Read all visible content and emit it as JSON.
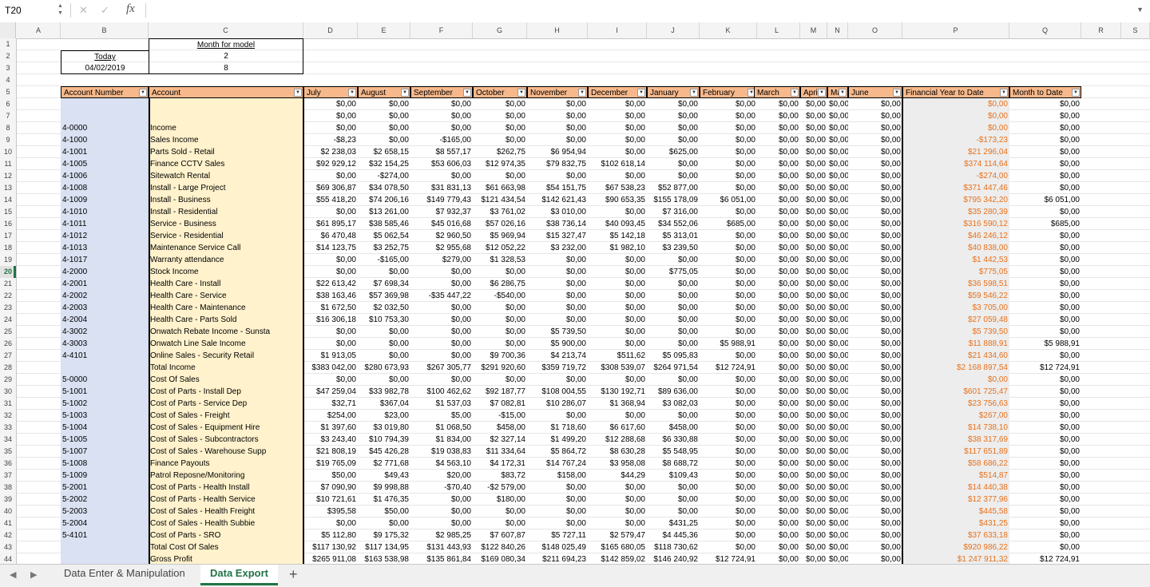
{
  "formula_bar": {
    "name_box": "T20",
    "fx_label": "fx",
    "formula": "",
    "cancel_icon": "close-icon",
    "confirm_icon": "check-icon"
  },
  "columns": [
    "A",
    "B",
    "C",
    "D",
    "E",
    "F",
    "G",
    "H",
    "I",
    "J",
    "K",
    "L",
    "M",
    "N",
    "O",
    "P",
    "Q",
    "R",
    "S"
  ],
  "selected_row": 20,
  "info": {
    "today_label": "Today",
    "today_value": "04/02/2019",
    "month_label": "Month for model",
    "month_value1": "2",
    "month_value2": "8"
  },
  "headers": [
    "Account Number",
    "Account",
    "July",
    "August",
    "September",
    "October",
    "November",
    "December",
    "January",
    "February",
    "March",
    "April",
    "May",
    "June",
    "Financial Year to Date",
    "Month to Date"
  ],
  "rows": [
    {
      "n": 6,
      "acct": "",
      "name": "",
      "v": [
        "$0,00",
        "$0,00",
        "$0,00",
        "$0,00",
        "$0,00",
        "$0,00",
        "$0,00",
        "$0,00",
        "$0,00",
        "$0,00",
        "$0,00",
        "$0,00"
      ],
      "fytd": "$0,00",
      "mtd": "$0,00"
    },
    {
      "n": 7,
      "acct": "",
      "name": "",
      "v": [
        "$0,00",
        "$0,00",
        "$0,00",
        "$0,00",
        "$0,00",
        "$0,00",
        "$0,00",
        "$0,00",
        "$0,00",
        "$0,00",
        "$0,00",
        "$0,00"
      ],
      "fytd": "$0,00",
      "mtd": "$0,00"
    },
    {
      "n": 8,
      "acct": "4-0000",
      "name": "Income",
      "v": [
        "$0,00",
        "$0,00",
        "$0,00",
        "$0,00",
        "$0,00",
        "$0,00",
        "$0,00",
        "$0,00",
        "$0,00",
        "$0,00",
        "$0,00",
        "$0,00"
      ],
      "fytd": "$0,00",
      "mtd": "$0,00"
    },
    {
      "n": 9,
      "acct": "4-1000",
      "name": "Sales Income",
      "v": [
        "-$8,23",
        "$0,00",
        "-$165,00",
        "$0,00",
        "$0,00",
        "$0,00",
        "$0,00",
        "$0,00",
        "$0,00",
        "$0,00",
        "$0,00",
        "$0,00"
      ],
      "fytd": "-$173,23",
      "mtd": "$0,00"
    },
    {
      "n": 10,
      "acct": "4-1001",
      "name": "Parts Sold - Retail",
      "v": [
        "$2 238,03",
        "$2 658,15",
        "$8 557,17",
        "$262,75",
        "$6 954,94",
        "$0,00",
        "$625,00",
        "$0,00",
        "$0,00",
        "$0,00",
        "$0,00",
        "$0,00"
      ],
      "fytd": "$21 296,04",
      "mtd": "$0,00"
    },
    {
      "n": 11,
      "acct": "4-1005",
      "name": "Finance CCTV Sales",
      "v": [
        "$92 929,12",
        "$32 154,25",
        "$53 606,03",
        "$12 974,35",
        "$79 832,75",
        "$102 618,14",
        "$0,00",
        "$0,00",
        "$0,00",
        "$0,00",
        "$0,00",
        "$0,00"
      ],
      "fytd": "$374 114,64",
      "mtd": "$0,00"
    },
    {
      "n": 12,
      "acct": "4-1006",
      "name": "Sitewatch Rental",
      "v": [
        "$0,00",
        "-$274,00",
        "$0,00",
        "$0,00",
        "$0,00",
        "$0,00",
        "$0,00",
        "$0,00",
        "$0,00",
        "$0,00",
        "$0,00",
        "$0,00"
      ],
      "fytd": "-$274,00",
      "mtd": "$0,00"
    },
    {
      "n": 13,
      "acct": "4-1008",
      "name": "Install - Large Project",
      "v": [
        "$69 306,87",
        "$34 078,50",
        "$31 831,13",
        "$61 663,98",
        "$54 151,75",
        "$67 538,23",
        "$52 877,00",
        "$0,00",
        "$0,00",
        "$0,00",
        "$0,00",
        "$0,00"
      ],
      "fytd": "$371 447,46",
      "mtd": "$0,00"
    },
    {
      "n": 14,
      "acct": "4-1009",
      "name": "Install - Business",
      "v": [
        "$55 418,20",
        "$74 206,16",
        "$149 779,43",
        "$121 434,54",
        "$142 621,43",
        "$90 653,35",
        "$155 178,09",
        "$6 051,00",
        "$0,00",
        "$0,00",
        "$0,00",
        "$0,00"
      ],
      "fytd": "$795 342,20",
      "mtd": "$6 051,00"
    },
    {
      "n": 15,
      "acct": "4-1010",
      "name": "Install - Residential",
      "v": [
        "$0,00",
        "$13 261,00",
        "$7 932,37",
        "$3 761,02",
        "$3 010,00",
        "$0,00",
        "$7 316,00",
        "$0,00",
        "$0,00",
        "$0,00",
        "$0,00",
        "$0,00"
      ],
      "fytd": "$35 280,39",
      "mtd": "$0,00"
    },
    {
      "n": 16,
      "acct": "4-1011",
      "name": "Service - Business",
      "v": [
        "$61 895,17",
        "$38 585,46",
        "$45 016,68",
        "$57 026,16",
        "$38 736,14",
        "$40 093,45",
        "$34 552,06",
        "$685,00",
        "$0,00",
        "$0,00",
        "$0,00",
        "$0,00"
      ],
      "fytd": "$316 590,12",
      "mtd": "$685,00"
    },
    {
      "n": 17,
      "acct": "4-1012",
      "name": "Service - Residential",
      "v": [
        "$6 470,48",
        "$5 062,54",
        "$2 960,50",
        "$5 969,94",
        "$15 327,47",
        "$5 142,18",
        "$5 313,01",
        "$0,00",
        "$0,00",
        "$0,00",
        "$0,00",
        "$0,00"
      ],
      "fytd": "$46 246,12",
      "mtd": "$0,00"
    },
    {
      "n": 18,
      "acct": "4-1013",
      "name": "Maintenance Service Call",
      "v": [
        "$14 123,75",
        "$3 252,75",
        "$2 955,68",
        "$12 052,22",
        "$3 232,00",
        "$1 982,10",
        "$3 239,50",
        "$0,00",
        "$0,00",
        "$0,00",
        "$0,00",
        "$0,00"
      ],
      "fytd": "$40 838,00",
      "mtd": "$0,00"
    },
    {
      "n": 19,
      "acct": "4-1017",
      "name": "Warranty attendance",
      "v": [
        "$0,00",
        "-$165,00",
        "$279,00",
        "$1 328,53",
        "$0,00",
        "$0,00",
        "$0,00",
        "$0,00",
        "$0,00",
        "$0,00",
        "$0,00",
        "$0,00"
      ],
      "fytd": "$1 442,53",
      "mtd": "$0,00"
    },
    {
      "n": 20,
      "acct": "4-2000",
      "name": "Stock Income",
      "v": [
        "$0,00",
        "$0,00",
        "$0,00",
        "$0,00",
        "$0,00",
        "$0,00",
        "$775,05",
        "$0,00",
        "$0,00",
        "$0,00",
        "$0,00",
        "$0,00"
      ],
      "fytd": "$775,05",
      "mtd": "$0,00"
    },
    {
      "n": 21,
      "acct": "4-2001",
      "name": "Health Care - Install",
      "v": [
        "$22 613,42",
        "$7 698,34",
        "$0,00",
        "$6 286,75",
        "$0,00",
        "$0,00",
        "$0,00",
        "$0,00",
        "$0,00",
        "$0,00",
        "$0,00",
        "$0,00"
      ],
      "fytd": "$36 598,51",
      "mtd": "$0,00"
    },
    {
      "n": 22,
      "acct": "4-2002",
      "name": "Health Care - Service",
      "v": [
        "$38 163,46",
        "$57 369,98",
        "-$35 447,22",
        "-$540,00",
        "$0,00",
        "$0,00",
        "$0,00",
        "$0,00",
        "$0,00",
        "$0,00",
        "$0,00",
        "$0,00"
      ],
      "fytd": "$59 546,22",
      "mtd": "$0,00"
    },
    {
      "n": 23,
      "acct": "4-2003",
      "name": "Health Care - Maintenance",
      "v": [
        "$1 672,50",
        "$2 032,50",
        "$0,00",
        "$0,00",
        "$0,00",
        "$0,00",
        "$0,00",
        "$0,00",
        "$0,00",
        "$0,00",
        "$0,00",
        "$0,00"
      ],
      "fytd": "$3 705,00",
      "mtd": "$0,00"
    },
    {
      "n": 24,
      "acct": "4-2004",
      "name": "Health Care - Parts Sold",
      "v": [
        "$16 306,18",
        "$10 753,30",
        "$0,00",
        "$0,00",
        "$0,00",
        "$0,00",
        "$0,00",
        "$0,00",
        "$0,00",
        "$0,00",
        "$0,00",
        "$0,00"
      ],
      "fytd": "$27 059,48",
      "mtd": "$0,00"
    },
    {
      "n": 25,
      "acct": "4-3002",
      "name": "Onwatch Rebate Income - Sunsta",
      "v": [
        "$0,00",
        "$0,00",
        "$0,00",
        "$0,00",
        "$5 739,50",
        "$0,00",
        "$0,00",
        "$0,00",
        "$0,00",
        "$0,00",
        "$0,00",
        "$0,00"
      ],
      "fytd": "$5 739,50",
      "mtd": "$0,00"
    },
    {
      "n": 26,
      "acct": "4-3003",
      "name": "Onwatch Line Sale Income",
      "v": [
        "$0,00",
        "$0,00",
        "$0,00",
        "$0,00",
        "$5 900,00",
        "$0,00",
        "$0,00",
        "$5 988,91",
        "$0,00",
        "$0,00",
        "$0,00",
        "$0,00"
      ],
      "fytd": "$11 888,91",
      "mtd": "$5 988,91"
    },
    {
      "n": 27,
      "acct": "4-4101",
      "name": "Online Sales - Security Retail",
      "v": [
        "$1 913,05",
        "$0,00",
        "$0,00",
        "$9 700,36",
        "$4 213,74",
        "$511,62",
        "$5 095,83",
        "$0,00",
        "$0,00",
        "$0,00",
        "$0,00",
        "$0,00"
      ],
      "fytd": "$21 434,60",
      "mtd": "$0,00"
    },
    {
      "n": 28,
      "acct": "",
      "name": "Total Income",
      "v": [
        "$383 042,00",
        "$280 673,93",
        "$267 305,77",
        "$291 920,60",
        "$359 719,72",
        "$308 539,07",
        "$264 971,54",
        "$12 724,91",
        "$0,00",
        "$0,00",
        "$0,00",
        "$0,00"
      ],
      "fytd": "$2 168 897,54",
      "mtd": "$12 724,91"
    },
    {
      "n": 29,
      "acct": "5-0000",
      "name": "Cost Of Sales",
      "v": [
        "$0,00",
        "$0,00",
        "$0,00",
        "$0,00",
        "$0,00",
        "$0,00",
        "$0,00",
        "$0,00",
        "$0,00",
        "$0,00",
        "$0,00",
        "$0,00"
      ],
      "fytd": "$0,00",
      "mtd": "$0,00"
    },
    {
      "n": 30,
      "acct": "5-1001",
      "name": "Cost of Parts - Install Dep",
      "v": [
        "$47 259,04",
        "$33 982,78",
        "$100 462,62",
        "$92 187,77",
        "$108 004,55",
        "$130 192,71",
        "$89 636,00",
        "$0,00",
        "$0,00",
        "$0,00",
        "$0,00",
        "$0,00"
      ],
      "fytd": "$601 725,47",
      "mtd": "$0,00"
    },
    {
      "n": 31,
      "acct": "5-1002",
      "name": "Cost of Parts - Service Dep",
      "v": [
        "$32,71",
        "$367,04",
        "$1 537,03",
        "$7 082,81",
        "$10 286,07",
        "$1 368,94",
        "$3 082,03",
        "$0,00",
        "$0,00",
        "$0,00",
        "$0,00",
        "$0,00"
      ],
      "fytd": "$23 756,63",
      "mtd": "$0,00"
    },
    {
      "n": 32,
      "acct": "5-1003",
      "name": "Cost of Sales - Freight",
      "v": [
        "$254,00",
        "$23,00",
        "$5,00",
        "-$15,00",
        "$0,00",
        "$0,00",
        "$0,00",
        "$0,00",
        "$0,00",
        "$0,00",
        "$0,00",
        "$0,00"
      ],
      "fytd": "$267,00",
      "mtd": "$0,00"
    },
    {
      "n": 33,
      "acct": "5-1004",
      "name": "Cost of Sales - Equipment Hire",
      "v": [
        "$1 397,60",
        "$3 019,80",
        "$1 068,50",
        "$458,00",
        "$1 718,60",
        "$6 617,60",
        "$458,00",
        "$0,00",
        "$0,00",
        "$0,00",
        "$0,00",
        "$0,00"
      ],
      "fytd": "$14 738,10",
      "mtd": "$0,00"
    },
    {
      "n": 34,
      "acct": "5-1005",
      "name": "Cost of Sales - Subcontractors",
      "v": [
        "$3 243,40",
        "$10 794,39",
        "$1 834,00",
        "$2 327,14",
        "$1 499,20",
        "$12 288,68",
        "$6 330,88",
        "$0,00",
        "$0,00",
        "$0,00",
        "$0,00",
        "$0,00"
      ],
      "fytd": "$38 317,69",
      "mtd": "$0,00"
    },
    {
      "n": 35,
      "acct": "5-1007",
      "name": "Cost of Sales - Warehouse Supp",
      "v": [
        "$21 808,19",
        "$45 426,28",
        "$19 038,83",
        "$11 334,64",
        "$5 864,72",
        "$8 630,28",
        "$5 548,95",
        "$0,00",
        "$0,00",
        "$0,00",
        "$0,00",
        "$0,00"
      ],
      "fytd": "$117 651,89",
      "mtd": "$0,00"
    },
    {
      "n": 36,
      "acct": "5-1008",
      "name": "Finance Payouts",
      "v": [
        "$19 765,09",
        "$2 771,68",
        "$4 563,10",
        "$4 172,31",
        "$14 767,24",
        "$3 958,08",
        "$8 688,72",
        "$0,00",
        "$0,00",
        "$0,00",
        "$0,00",
        "$0,00"
      ],
      "fytd": "$58 686,22",
      "mtd": "$0,00"
    },
    {
      "n": 37,
      "acct": "5-1009",
      "name": "Patrol Reposne/Monitoring",
      "v": [
        "$50,00",
        "$49,43",
        "$20,00",
        "$83,72",
        "$158,00",
        "$44,29",
        "$109,43",
        "$0,00",
        "$0,00",
        "$0,00",
        "$0,00",
        "$0,00"
      ],
      "fytd": "$514,87",
      "mtd": "$0,00"
    },
    {
      "n": 38,
      "acct": "5-2001",
      "name": "Cost of Parts - Health Install",
      "v": [
        "$7 090,90",
        "$9 998,88",
        "-$70,40",
        "-$2 579,00",
        "$0,00",
        "$0,00",
        "$0,00",
        "$0,00",
        "$0,00",
        "$0,00",
        "$0,00",
        "$0,00"
      ],
      "fytd": "$14 440,38",
      "mtd": "$0,00"
    },
    {
      "n": 39,
      "acct": "5-2002",
      "name": "Cost of Parts - Health Service",
      "v": [
        "$10 721,61",
        "$1 476,35",
        "$0,00",
        "$180,00",
        "$0,00",
        "$0,00",
        "$0,00",
        "$0,00",
        "$0,00",
        "$0,00",
        "$0,00",
        "$0,00"
      ],
      "fytd": "$12 377,96",
      "mtd": "$0,00"
    },
    {
      "n": 40,
      "acct": "5-2003",
      "name": "Cost of Sales - Health Freight",
      "v": [
        "$395,58",
        "$50,00",
        "$0,00",
        "$0,00",
        "$0,00",
        "$0,00",
        "$0,00",
        "$0,00",
        "$0,00",
        "$0,00",
        "$0,00",
        "$0,00"
      ],
      "fytd": "$445,58",
      "mtd": "$0,00"
    },
    {
      "n": 41,
      "acct": "5-2004",
      "name": "Cost of Sales - Health Subbie",
      "v": [
        "$0,00",
        "$0,00",
        "$0,00",
        "$0,00",
        "$0,00",
        "$0,00",
        "$431,25",
        "$0,00",
        "$0,00",
        "$0,00",
        "$0,00",
        "$0,00"
      ],
      "fytd": "$431,25",
      "mtd": "$0,00"
    },
    {
      "n": 42,
      "acct": "5-4101",
      "name": "Cost of Parts - SRO",
      "v": [
        "$5 112,80",
        "$9 175,32",
        "$2 985,25",
        "$7 607,87",
        "$5 727,11",
        "$2 579,47",
        "$4 445,36",
        "$0,00",
        "$0,00",
        "$0,00",
        "$0,00",
        "$0,00"
      ],
      "fytd": "$37 633,18",
      "mtd": "$0,00"
    },
    {
      "n": 43,
      "acct": "",
      "name": "Total Cost Of Sales",
      "v": [
        "$117 130,92",
        "$117 134,95",
        "$131 443,93",
        "$122 840,26",
        "$148 025,49",
        "$165 680,05",
        "$118 730,62",
        "$0,00",
        "$0,00",
        "$0,00",
        "$0,00",
        "$0,00"
      ],
      "fytd": "$920 986,22",
      "mtd": "$0,00"
    },
    {
      "n": 44,
      "acct": "",
      "name": "Gross Profit",
      "v": [
        "$265 911,08",
        "$163 538,98",
        "$135 861,84",
        "$169 080,34",
        "$211 694,23",
        "$142 859,02",
        "$146 240,92",
        "$12 724,91",
        "$0,00",
        "$0,00",
        "$0,00",
        "$0,00"
      ],
      "fytd": "$1 247 911,32",
      "mtd": "$12 724,91"
    }
  ],
  "sheet_tabs": [
    {
      "label": "Data Enter & Manipulation",
      "active": false
    },
    {
      "label": "Data Export",
      "active": true
    }
  ],
  "add_sheet": "+",
  "colors": {
    "header_fill": "#f7b98c",
    "account_num_fill": "#d9e1f2",
    "account_fill": "#fff2cc",
    "fytd_fill": "#ededed",
    "accent": "#217346",
    "orange_text": "#e8711b"
  }
}
